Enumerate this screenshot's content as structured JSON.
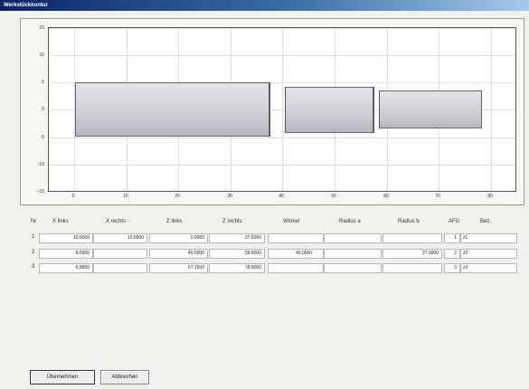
{
  "window": {
    "title": "Werkstückkontur"
  },
  "chart": {
    "y_ticks": [
      "15",
      "10",
      "5",
      "0",
      "-5",
      "-10",
      "-15"
    ],
    "x_ticks": [
      "0",
      "10",
      "20",
      "30",
      "40",
      "50",
      "60",
      "70",
      "80"
    ]
  },
  "chart_data": {
    "type": "profile",
    "title": "",
    "xlabel": "",
    "ylabel": "",
    "xlim": [
      -5,
      85
    ],
    "ylim": [
      -15,
      15
    ],
    "grid": true,
    "segments": [
      {
        "z_start": 0,
        "z_end": 37.6,
        "radius": 5
      },
      {
        "z_start": 40.5,
        "z_end": 57.6,
        "radius": 4.25
      },
      {
        "z_start": 58.6,
        "z_end": 78.6,
        "radius": 3.5
      }
    ],
    "transitions": [
      {
        "from_z": 37.6,
        "to_z": 40.5,
        "from_radius": 5,
        "to_radius": 4.25
      },
      {
        "from_z": 57.6,
        "to_z": 58.6,
        "from_radius": 4.25,
        "to_radius": 3.5
      }
    ]
  },
  "table": {
    "headers": [
      "Nr",
      "X links",
      "X rechts",
      "Z links",
      "Z rechts",
      "Winkel",
      "Radius a",
      "Radius b",
      "AFG",
      "Bez."
    ],
    "rows": [
      {
        "nr": "1",
        "x_links": "10.0000",
        "x_rechts": "10.0000",
        "z_links": "0.0000",
        "z_rechts": "37.6000",
        "winkel": "",
        "radius_a": "",
        "radius_b": "",
        "afg": "1",
        "bez": "z1"
      },
      {
        "nr": "2",
        "x_links": "8.5000",
        "x_rechts": "",
        "z_links": "40.5000",
        "z_rechts": "58.6000",
        "winkel": "40.0000",
        "radius_a": "",
        "radius_b": "37.0000",
        "afg": "2",
        "bez": "z2"
      },
      {
        "nr": "3",
        "x_links": "6.8850",
        "x_rechts": "",
        "z_links": "67.1600",
        "z_rechts": "78.6000",
        "winkel": "",
        "radius_a": "",
        "radius_b": "",
        "afg": "3",
        "bez": "z3"
      }
    ]
  },
  "buttons": {
    "accept": "Übernehmen",
    "cancel": "Abbrechen"
  }
}
